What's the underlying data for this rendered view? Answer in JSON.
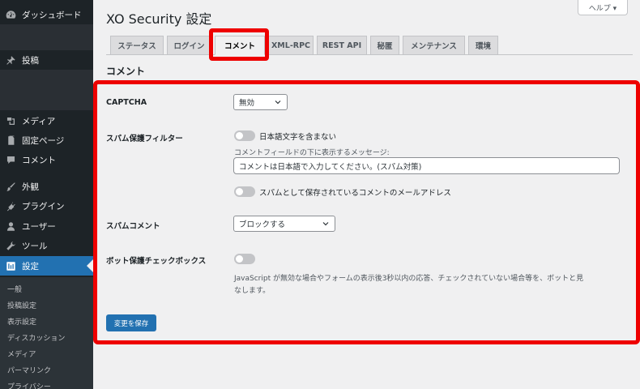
{
  "sidebar": {
    "dashboard": "ダッシュボード",
    "posts": "投稿",
    "media": "メディア",
    "pages": "固定ページ",
    "comments": "コメント",
    "appearance": "外観",
    "plugins": "プラグイン",
    "users": "ユーザー",
    "tools": "ツール",
    "settings": "設定",
    "submenu": [
      "一般",
      "投稿設定",
      "表示設定",
      "ディスカッション",
      "メディア",
      "パーマリンク",
      "プライバシー"
    ]
  },
  "header": {
    "title": "XO Security 設定",
    "help": "ヘルプ ▾"
  },
  "tabs": [
    "ステータス",
    "ログイン",
    "コメント",
    "XML-RPC",
    "REST API",
    "秘匿",
    "メンテナンス",
    "環境"
  ],
  "section_title": "コメント",
  "form": {
    "captcha_label": "CAPTCHA",
    "captcha_value": "無効",
    "spam_filter_label": "スパム保護フィルター",
    "no_japanese_toggle": "日本語文字を含まない",
    "message_desc": "コメントフィールドの下に表示するメッセージ:",
    "message_value": "コメントは日本語で入力してください。(スパム対策)",
    "spam_email_toggle": "スパムとして保存されているコメントのメールアドレス",
    "spam_comment_label": "スパムコメント",
    "spam_comment_value": "ブロックする",
    "bot_label": "ボット保護チェックボックス",
    "bot_desc_line1": "JavaScript が無効な場合やフォームの表示後3秒以内の応答、チェックされていない場合等を、ボットと見",
    "bot_desc_line2": "なします。",
    "save_button": "変更を保存"
  },
  "colors": {
    "sidebar_bg": "#1d2327",
    "accent": "#2271b1",
    "highlight": "#ee0000"
  }
}
